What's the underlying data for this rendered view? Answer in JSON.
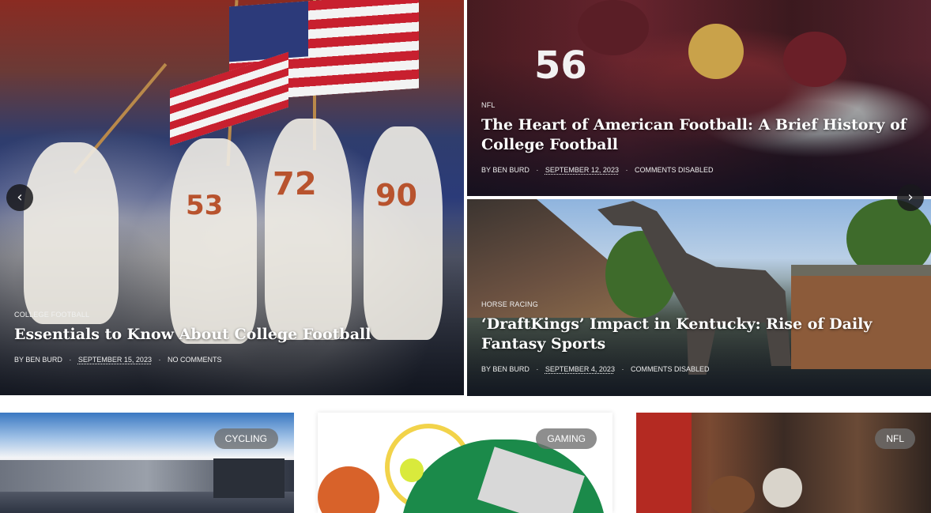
{
  "featured": {
    "main": {
      "category": "COLLEGE FOOTBALL",
      "title": "Essentials to Know About College Football",
      "byline_prefix": "BY",
      "author": "BEN BURD",
      "date": "SEPTEMBER 15, 2023",
      "comments": "NO COMMENTS"
    },
    "top_right": {
      "category": "NFL",
      "title": "The Heart of American Football: A Brief History of College Football",
      "byline_prefix": "BY",
      "author": "BEN BURD",
      "date": "SEPTEMBER 12, 2023",
      "comments": "COMMENTS DISABLED"
    },
    "bottom_right": {
      "category": "HORSE RACING",
      "title": "‘DraftKings’ Impact in Kentucky: Rise of Daily Fantasy Sports",
      "byline_prefix": "BY",
      "author": "BEN BURD",
      "date": "SEPTEMBER 4, 2023",
      "comments": "COMMENTS DISABLED"
    }
  },
  "slider": {
    "prev_icon": "chevron-left-icon",
    "next_icon": "chevron-right-icon",
    "prev_glyph": "‹",
    "next_glyph": "›"
  },
  "cards": [
    {
      "category": "CYCLING"
    },
    {
      "category": "GAMING"
    },
    {
      "category": "NFL"
    }
  ],
  "colors": {
    "overlay_text": "#ffffff",
    "pill_bg": "#6e6e6e",
    "arrow_bg": "#19191c"
  }
}
